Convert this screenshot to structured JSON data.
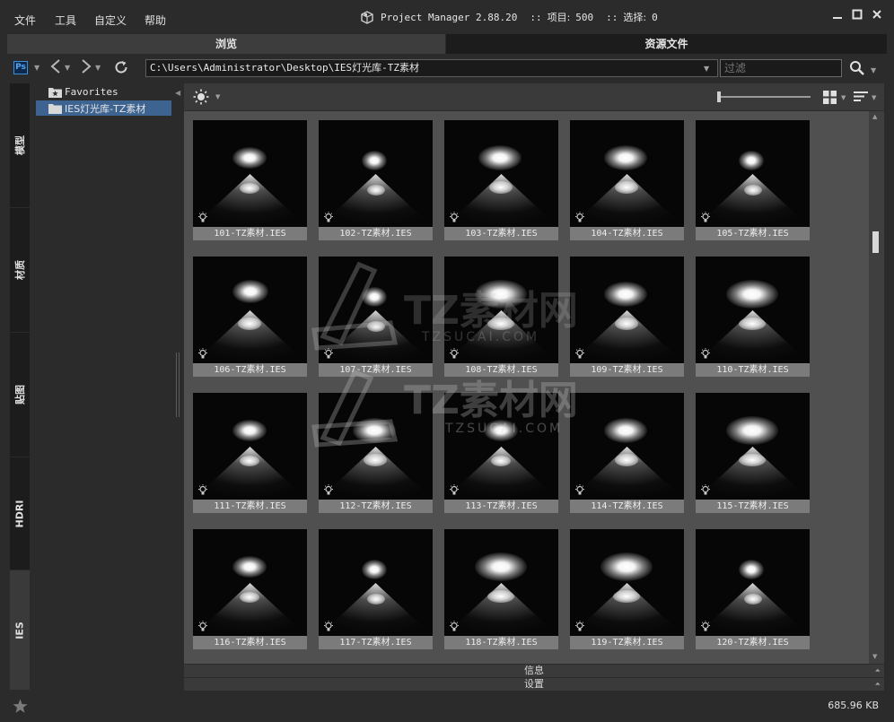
{
  "menu": {
    "file": "文件",
    "tools": "工具",
    "custom": "自定义",
    "help": "帮助"
  },
  "window": {
    "title": "Project Manager 2.88.20",
    "sep": "::",
    "items_label": "项目:",
    "items_count": "500",
    "selection_label": "选择:",
    "selection_count": "0"
  },
  "tabs": {
    "browse": "浏览",
    "assets": "资源文件"
  },
  "nav": {
    "path": "C:\\Users\\Administrator\\Desktop\\IES灯光库-TZ素材",
    "filter_placeholder": "过滤",
    "ps_label": "Ps"
  },
  "side_tabs": [
    "模型",
    "材质",
    "贴图",
    "HDRI",
    "IES"
  ],
  "active_side_tab": "IES",
  "tree": [
    {
      "label": "Favorites",
      "icon": "star-folder-icon"
    },
    {
      "label": "IES灯光库-TZ素材",
      "icon": "folder-icon",
      "selected": true
    }
  ],
  "grid": {
    "items": [
      {
        "label": "101-TZ素材.IES",
        "variant": "b"
      },
      {
        "label": "102-TZ素材.IES",
        "variant": "c"
      },
      {
        "label": "103-TZ素材.IES",
        "variant": "a"
      },
      {
        "label": "104-TZ素材.IES",
        "variant": "a"
      },
      {
        "label": "105-TZ素材.IES",
        "variant": "c"
      },
      {
        "label": "106-TZ素材.IES",
        "variant": "d"
      },
      {
        "label": "107-TZ素材.IES",
        "variant": "c"
      },
      {
        "label": "108-TZ素材.IES",
        "variant": "e"
      },
      {
        "label": "109-TZ素材.IES",
        "variant": "a"
      },
      {
        "label": "110-TZ素材.IES",
        "variant": "e"
      },
      {
        "label": "111-TZ素材.IES",
        "variant": "b"
      },
      {
        "label": "112-TZ素材.IES",
        "variant": "a"
      },
      {
        "label": "113-TZ素材.IES",
        "variant": "b"
      },
      {
        "label": "114-TZ素材.IES",
        "variant": "a"
      },
      {
        "label": "115-TZ素材.IES",
        "variant": "e"
      },
      {
        "label": "116-TZ素材.IES",
        "variant": "b"
      },
      {
        "label": "117-TZ素材.IES",
        "variant": "c"
      },
      {
        "label": "118-TZ素材.IES",
        "variant": "e"
      },
      {
        "label": "119-TZ素材.IES",
        "variant": "e"
      },
      {
        "label": "120-TZ素材.IES",
        "variant": "c"
      }
    ]
  },
  "panels": {
    "info": "信息",
    "settings": "设置"
  },
  "status": {
    "file_size": "685.96 KB"
  },
  "watermark": {
    "text": "TZ素材网",
    "domain": "TZSUCAI.COM"
  },
  "colors": {
    "selection": "#3d6391",
    "tile_label_bg": "#7b7b7b",
    "grid_bg": "#505050",
    "ps_blue": "#54a7f2"
  }
}
